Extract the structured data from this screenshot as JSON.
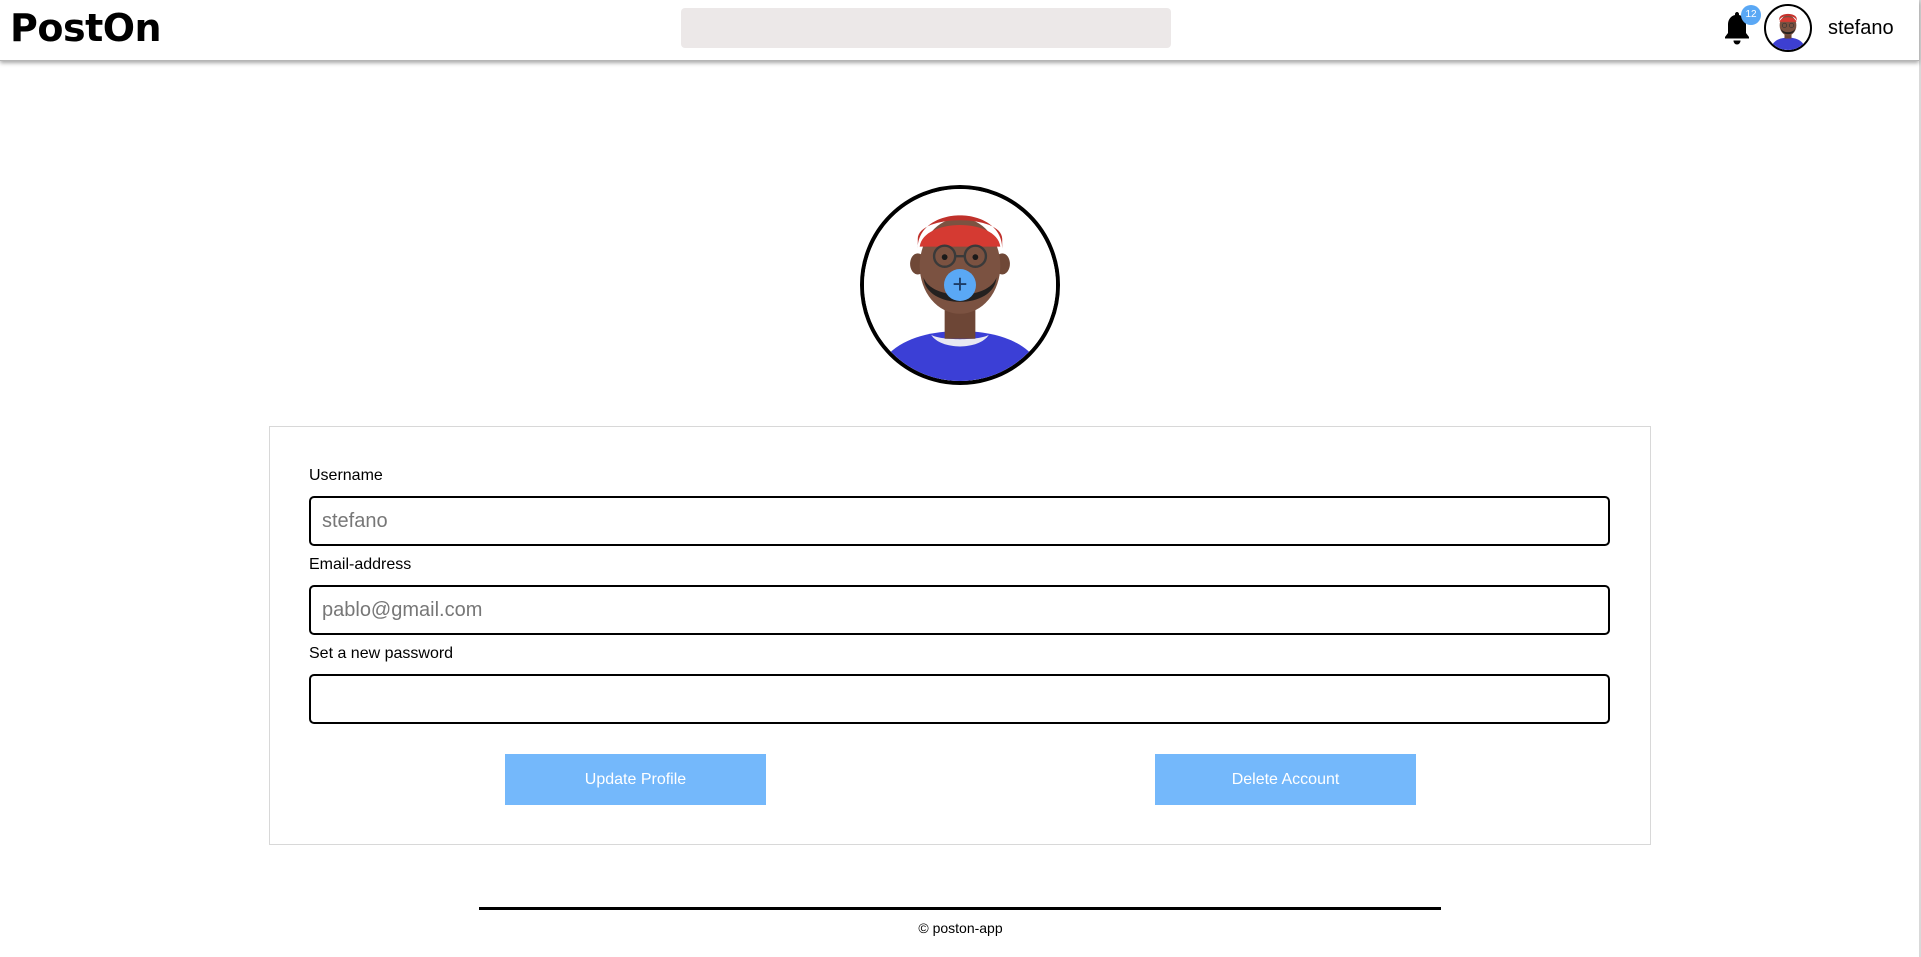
{
  "header": {
    "brand": "PostOn",
    "search_placeholder": "",
    "notification_count": "12",
    "username": "stefano"
  },
  "profile": {
    "add_photo_icon": "+"
  },
  "form": {
    "username_label": "Username",
    "username_placeholder": "stefano",
    "email_label": "Email-address",
    "email_placeholder": "pablo@gmail.com",
    "password_label": "Set a new password",
    "password_placeholder": "",
    "update_button": "Update Profile",
    "delete_button": "Delete Account"
  },
  "footer": {
    "copyright": "© poston-app"
  },
  "colors": {
    "accent": "#74b8fb",
    "badge": "#5aa8f5",
    "search_bg": "#ece8e8"
  },
  "icons": {
    "bell": "bell-icon",
    "add_photo": "plus-icon"
  }
}
